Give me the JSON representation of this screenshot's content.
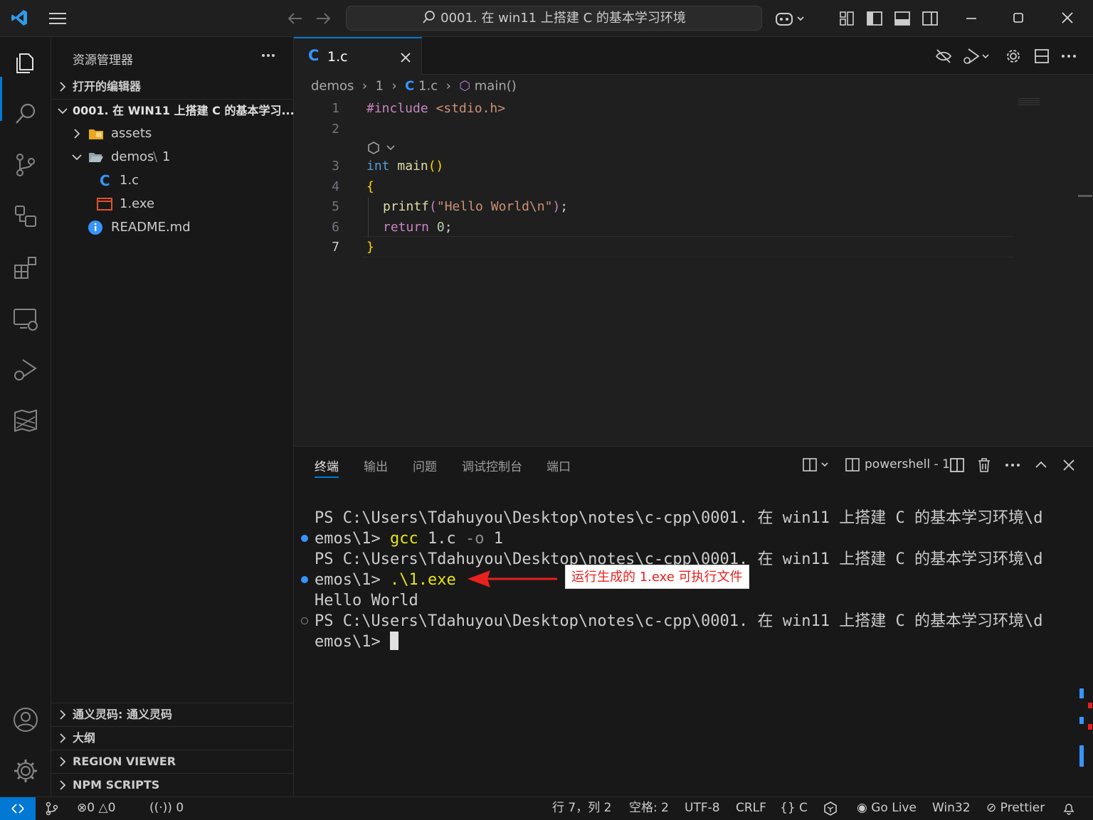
{
  "titlebar": {
    "search_text": "0001. 在 win11 上搭建 C 的基本学习环境"
  },
  "activity_bar": {
    "items": [
      "explorer-icon",
      "search-icon",
      "source-control-icon",
      "remote-explorer-icon",
      "extensions-icon",
      "remote-window-icon",
      "run-debug-icon",
      "map-icon",
      "account-icon",
      "settings-gear-icon"
    ]
  },
  "sidebar": {
    "title": "资源管理器",
    "open_editors": "打开的编辑器",
    "workspace": "0001. 在 WIN11 上搭建 C 的基本学习...",
    "tree": [
      {
        "label": "assets",
        "type": "folder"
      },
      {
        "label": "demos",
        "sep": "\\",
        "sub": "1",
        "type": "folder-open"
      },
      {
        "label": "1.c",
        "type": "c-file"
      },
      {
        "label": "1.exe",
        "type": "exe-file"
      },
      {
        "label": "README.md",
        "type": "info-file"
      }
    ],
    "bottom_sections": [
      "通义灵码: 通义灵码",
      "大纲",
      "REGION VIEWER",
      "NPM SCRIPTS"
    ]
  },
  "editor": {
    "tab_label": "1.c",
    "breadcrumb": [
      "demos",
      "1",
      "1.c",
      "main()"
    ],
    "lines": [
      {
        "n": "1",
        "text": "#include <stdio.h>"
      },
      {
        "n": "2",
        "text": ""
      },
      {
        "n": "3",
        "text": "int main()"
      },
      {
        "n": "4",
        "text": "{"
      },
      {
        "n": "5",
        "text": "printf(\"Hello World\\n\");"
      },
      {
        "n": "6",
        "text": "return 0;"
      },
      {
        "n": "7",
        "text": "}"
      }
    ]
  },
  "panel": {
    "tabs": [
      "终端",
      "输出",
      "问题",
      "调试控制台",
      "端口"
    ],
    "terminal_name": "powershell - 1",
    "terminal_lines": [
      "PS C:\\Users\\Tdahuyou\\Desktop\\notes\\c-cpp\\0001. 在 win11 上搭建 C 的基本学习环境\\d",
      "emos\\1> ",
      "gcc",
      " 1.c ",
      "-o",
      " 1",
      "PS C:\\Users\\Tdahuyou\\Desktop\\notes\\c-cpp\\0001. 在 win11 上搭建 C 的基本学习环境\\d",
      "emos\\1> ",
      ".\\1.exe",
      "Hello World",
      "PS C:\\Users\\Tdahuyou\\Desktop\\notes\\c-cpp\\0001. 在 win11 上搭建 C 的基本学习环境\\d",
      "emos\\1> "
    ],
    "annotation": "运行生成的 1.exe 可执行文件"
  },
  "statusbar": {
    "errors": "0",
    "warnings": "0",
    "ports": "0",
    "position": "行 7，列 2",
    "spaces": "空格: 2",
    "encoding": "UTF-8",
    "eol": "CRLF",
    "language": "C",
    "go_live": "Go Live",
    "platform": "Win32",
    "prettier": "Prettier"
  },
  "colors": {
    "accent": "#0078d4",
    "annotation_red": "#e8201f",
    "terminal_cmd": "#e5e510"
  }
}
